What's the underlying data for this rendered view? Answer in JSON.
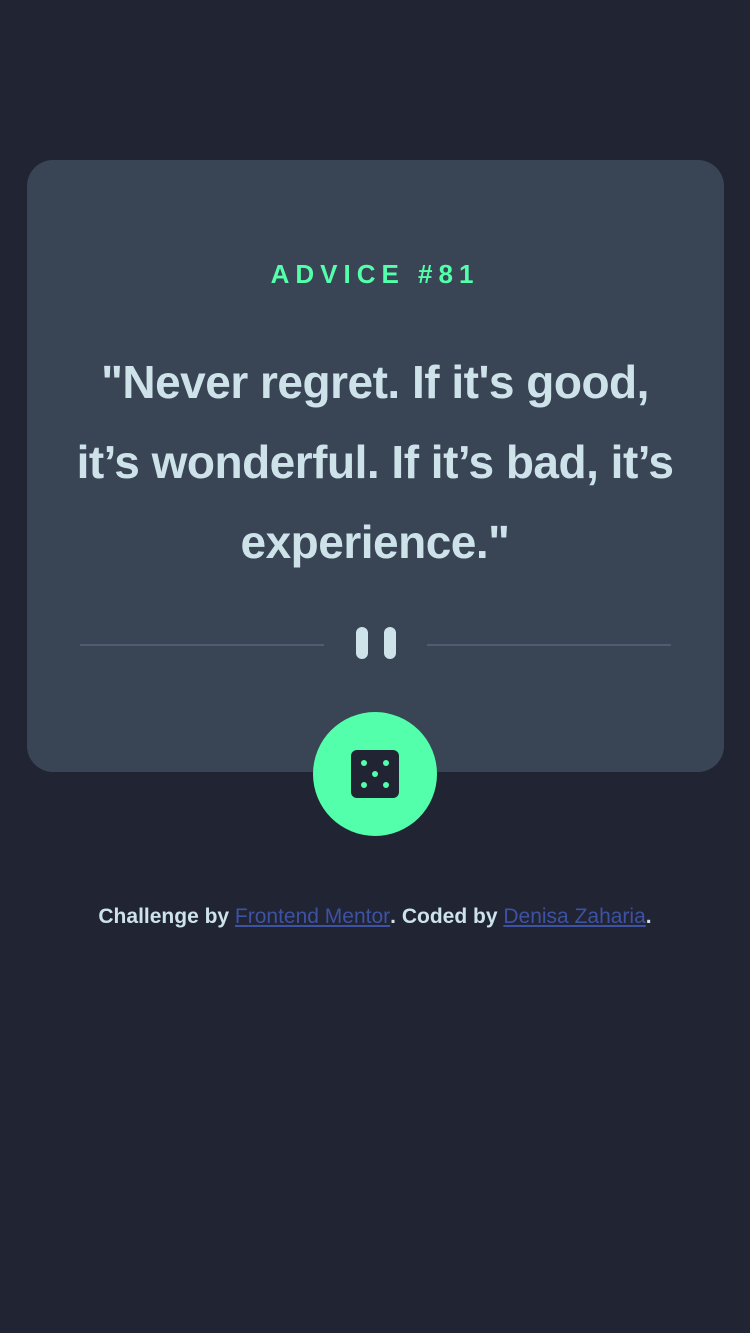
{
  "advice": {
    "label": "ADVICE #81",
    "quote": "\"Never regret. If it's good, it’s wonderful. If it’s bad, it’s experience.\""
  },
  "divider": {
    "icon": "pause-icon"
  },
  "dice_button": {
    "icon": "dice-icon"
  },
  "attribution": {
    "challenge_prefix": "Challenge by ",
    "frontend_mentor_link": "Frontend Mentor",
    "coded_by_text": ". Coded by ",
    "author_link": "Denisa Zaharia",
    "suffix": "."
  },
  "colors": {
    "background": "#202433",
    "card": "#394455",
    "accent": "#53ffaa",
    "text": "#cee3e9",
    "divider": "#4f5d74",
    "link": "#3e52a3"
  }
}
